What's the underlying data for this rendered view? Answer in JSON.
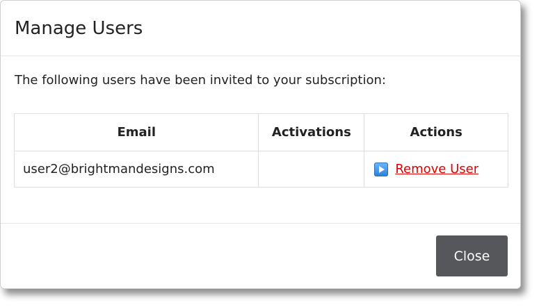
{
  "dialog": {
    "title": "Manage Users",
    "intro": "The following users have been invited to your subscription:"
  },
  "table": {
    "headers": [
      "Email",
      "Activations",
      "Actions"
    ],
    "rows": [
      {
        "email": "user2@brightmandesigns.com",
        "activations": "",
        "action_label": "Remove User",
        "action_icon": "play-icon"
      }
    ]
  },
  "footer": {
    "close_label": "Close"
  },
  "colors": {
    "link": "#e00000",
    "close_button": "#56575b",
    "icon": "#2a7fd9"
  }
}
